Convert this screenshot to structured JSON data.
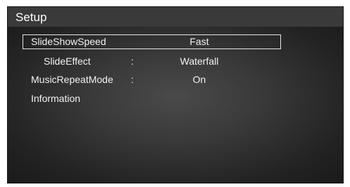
{
  "header": {
    "title": "Setup"
  },
  "menu": {
    "items": [
      {
        "label": "SlideShowSpeed",
        "colon": "",
        "value": "Fast"
      },
      {
        "label": "SlideEffect",
        "colon": ":",
        "value": "Waterfall"
      },
      {
        "label": "MusicRepeatMode",
        "colon": ":",
        "value": "On"
      },
      {
        "label": "Information",
        "colon": "",
        "value": ""
      }
    ]
  }
}
